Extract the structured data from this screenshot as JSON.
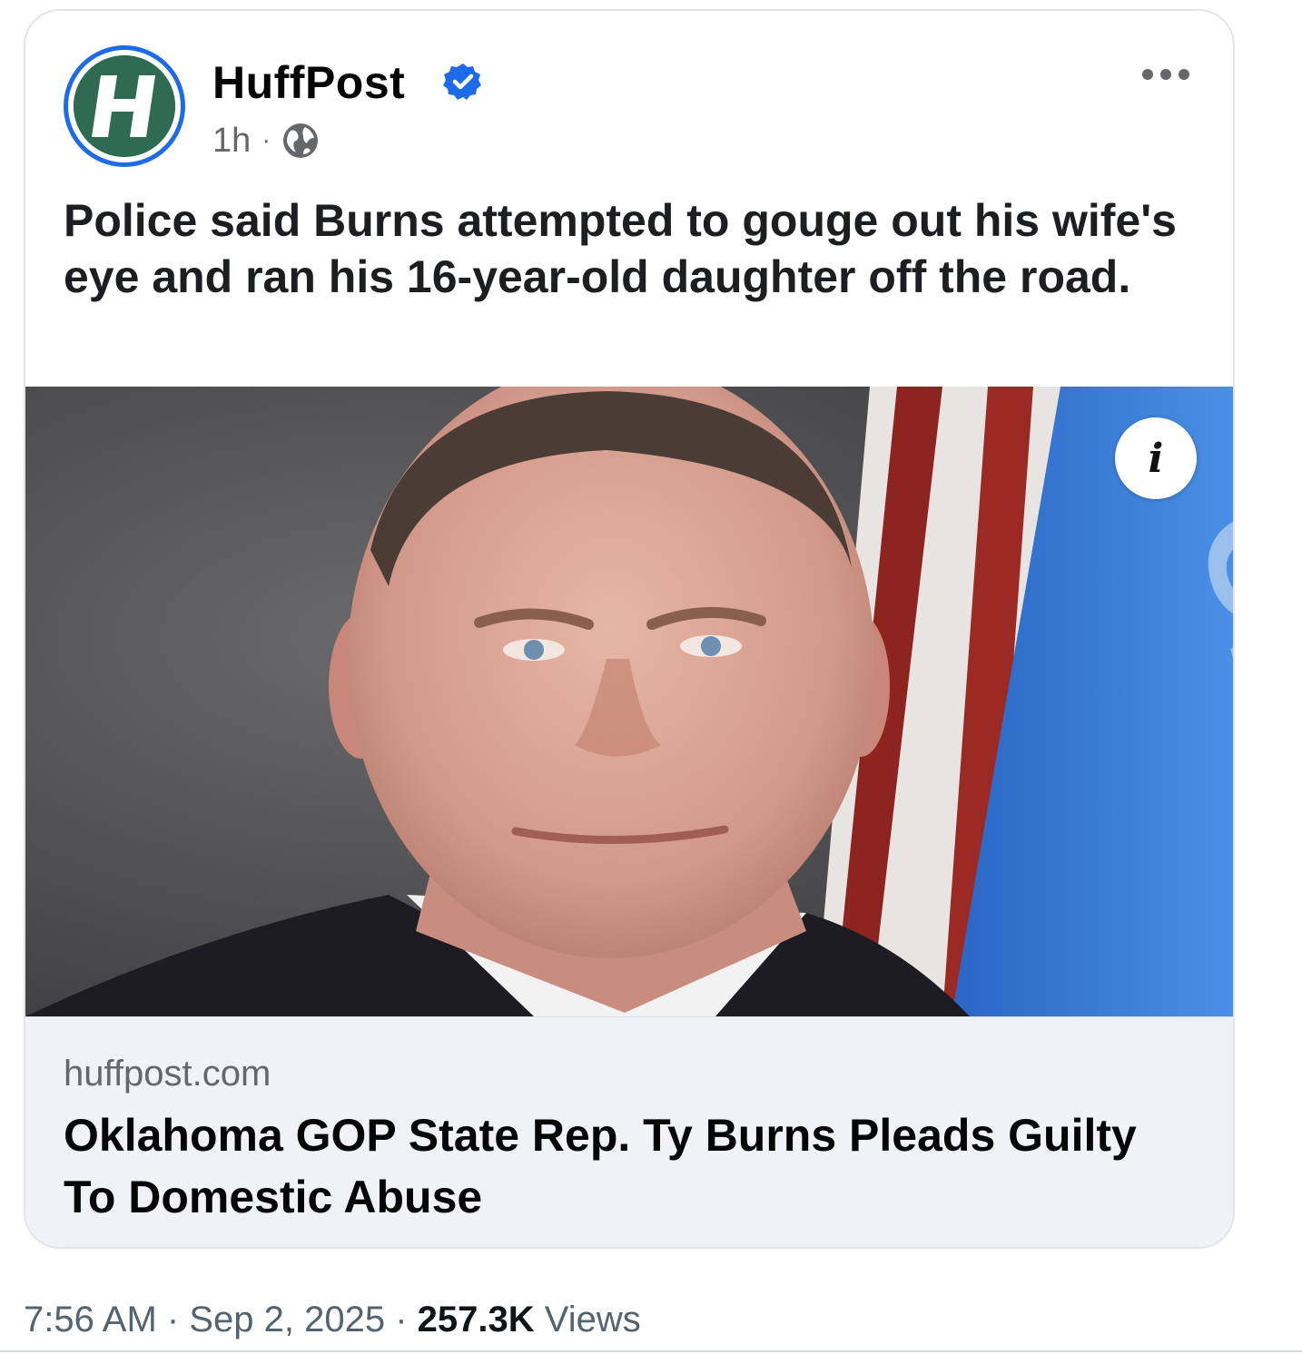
{
  "post": {
    "page_name": "HuffPost",
    "avatar_letter": "H",
    "time": "1h",
    "separator": "·",
    "caption": "Police said Burns attempted to gouge out his wife's eye and ran his 16-year-old daughter off the road.",
    "icons": [
      "verified-badge-icon",
      "globe-icon",
      "more-options-icon",
      "info-icon"
    ],
    "colors": {
      "avatar_ring": "#1d6be8",
      "avatar_bg": "#2f6b53",
      "verified": "#1d6be8"
    }
  },
  "link_preview": {
    "info_glyph": "i",
    "domain": "huffpost.com",
    "headline": "Oklahoma GOP State Rep. Ty Burns Pleads Guilty To Domestic Abuse"
  },
  "tweet_footer": {
    "time": "7:56 AM",
    "sep1": "·",
    "date": "Sep 2, 2025",
    "sep2": "·",
    "views_count": "257.3K",
    "views_label": "Views"
  }
}
